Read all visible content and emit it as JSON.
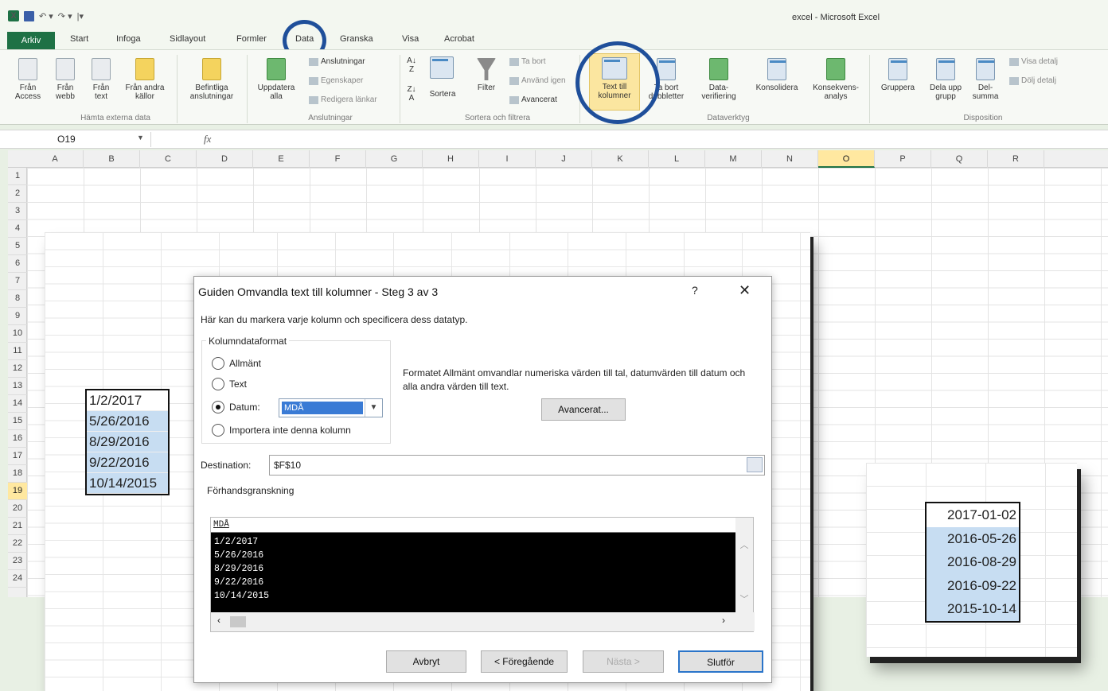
{
  "window": {
    "title": "excel - Microsoft Excel"
  },
  "tabs": [
    "Start",
    "Infoga",
    "Sidlayout",
    "Formler",
    "Data",
    "Granska",
    "Visa",
    "Acrobat"
  ],
  "file_tab": "Arkiv",
  "ribbon": {
    "external_data": {
      "access": "Från\nAccess",
      "web": "Från\nwebb",
      "text": "Från\ntext",
      "other": "Från andra\nkällor",
      "label": "Hämta externa data"
    },
    "existing": "Befintliga\nanslutningar",
    "connections": {
      "refresh": "Uppdatera\nalla",
      "items": [
        "Anslutningar",
        "Egenskaper",
        "Redigera länkar"
      ],
      "label": "Anslutningar"
    },
    "sort_filter": {
      "sort": "Sortera",
      "filter": "Filter",
      "items": [
        "Ta bort",
        "Använd igen",
        "Avancerat"
      ],
      "label": "Sortera och filtrera"
    },
    "data_tools": {
      "text_to_columns": "Text till\nkolumner",
      "remove_dup": "Ta bort\ndubbletter",
      "validation": "Data-\nverifiering",
      "consolidate": "Konsolidera",
      "whatif": "Konsekvens-\nanalys",
      "label": "Dataverktyg"
    },
    "outline": {
      "group": "Gruppera",
      "ungroup": "Dela upp\ngrupp",
      "subtotal": "Del-\nsumma",
      "items": [
        "Visa detalj",
        "Dölj detalj"
      ],
      "label": "Disposition"
    }
  },
  "formula_bar": {
    "name_box": "O19",
    "fx": "fx"
  },
  "columns": [
    "A",
    "B",
    "C",
    "D",
    "E",
    "F",
    "G",
    "H",
    "I",
    "J",
    "K",
    "L",
    "M",
    "N",
    "O",
    "P",
    "Q",
    "R"
  ],
  "selected_column": "O",
  "rows": [
    "1",
    "2",
    "3",
    "4",
    "5",
    "6",
    "7",
    "8",
    "9",
    "10",
    "11",
    "12",
    "13",
    "14",
    "15",
    "16",
    "17",
    "18",
    "19",
    "20",
    "21",
    "22",
    "23",
    "24"
  ],
  "selected_row": "19",
  "source_dates": [
    "1/2/2017",
    "5/26/2016",
    "8/29/2016",
    "9/22/2016",
    "10/14/2015"
  ],
  "dialog": {
    "title": "Guiden Omvandla text till kolumner - Steg 3 av 3",
    "help": "?",
    "close": "✕",
    "description": "Här kan du markera varje kolumn och specificera dess datatyp.",
    "group_label": "Kolumndataformat",
    "options": [
      "Allmänt",
      "Text",
      "Datum:",
      "Importera inte denna kolumn"
    ],
    "selected_option": "Datum:",
    "date_format": "MDÅ",
    "format_info": "Formatet Allmänt omvandlar numeriska värden till tal, datumvärden till datum och alla andra värden till text.",
    "advanced_button": "Avancerat...",
    "destination_label": "Destination:",
    "destination_value": "$F$10",
    "preview_label": "Förhandsgranskning",
    "preview_header": "MDÅ",
    "preview_rows": [
      "1/2/2017",
      "5/26/2016",
      "8/29/2016",
      "9/22/2016",
      "10/14/2015"
    ],
    "buttons": {
      "cancel": "Avbryt",
      "back": "< Föregående",
      "next": "Nästa >",
      "finish": "Slutför"
    }
  },
  "result_dates": [
    "2017-01-02",
    "2016-05-26",
    "2016-08-29",
    "2016-09-22",
    "2015-10-14"
  ],
  "colors": {
    "excel_green": "#1e7145",
    "highlight": "#c7ddf2",
    "circle": "#1f4f9a"
  }
}
